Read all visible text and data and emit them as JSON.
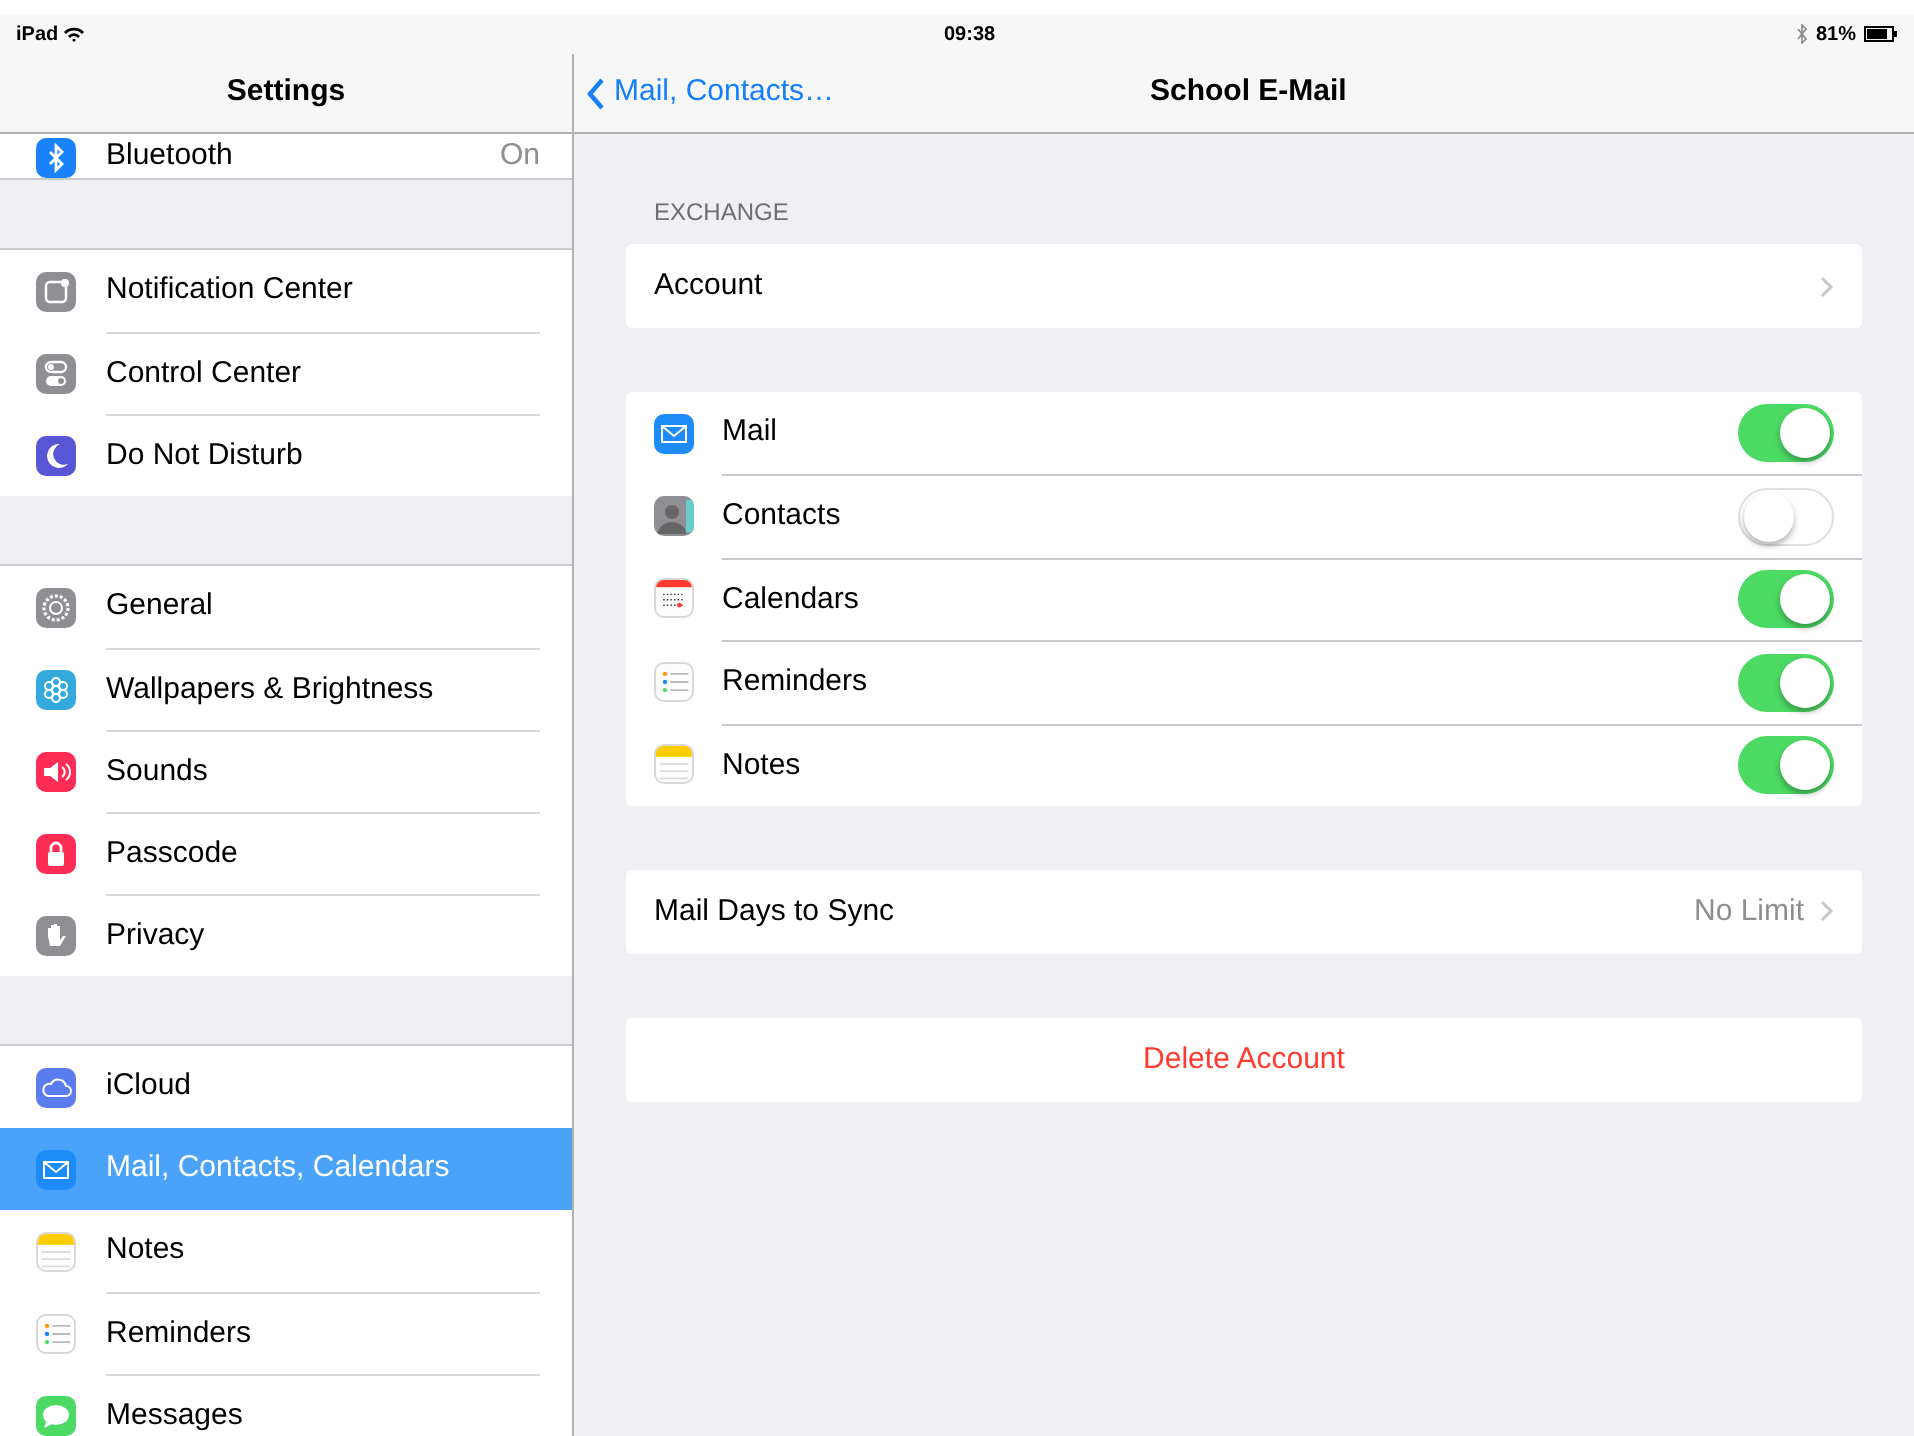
{
  "status_bar": {
    "device": "iPad",
    "time": "09:38",
    "battery": "81%"
  },
  "sidebar": {
    "title": "Settings",
    "groups": [
      [
        {
          "label": "Bluetooth",
          "value": "On",
          "selected": false
        }
      ],
      [
        {
          "label": "Notification Center",
          "selected": false
        },
        {
          "label": "Control Center",
          "selected": false
        },
        {
          "label": "Do Not Disturb",
          "selected": false
        }
      ],
      [
        {
          "label": "General",
          "selected": false
        },
        {
          "label": "Wallpapers & Brightness",
          "selected": false
        },
        {
          "label": "Sounds",
          "selected": false
        },
        {
          "label": "Passcode",
          "selected": false
        },
        {
          "label": "Privacy",
          "selected": false
        }
      ],
      [
        {
          "label": "iCloud",
          "selected": false
        },
        {
          "label": "Mail, Contacts, Calendars",
          "selected": true
        },
        {
          "label": "Notes",
          "selected": false
        },
        {
          "label": "Reminders",
          "selected": false
        },
        {
          "label": "Messages",
          "selected": false
        }
      ]
    ]
  },
  "detail": {
    "back": "Mail, Contacts…",
    "title": "School E-Mail",
    "section_header": "EXCHANGE",
    "account": "Account",
    "services": [
      {
        "label": "Mail",
        "on": true
      },
      {
        "label": "Contacts",
        "on": false
      },
      {
        "label": "Calendars",
        "on": true
      },
      {
        "label": "Reminders",
        "on": true
      },
      {
        "label": "Notes",
        "on": true
      }
    ],
    "mail_days": {
      "label": "Mail Days to Sync",
      "value": "No Limit"
    },
    "delete": "Delete Account"
  }
}
